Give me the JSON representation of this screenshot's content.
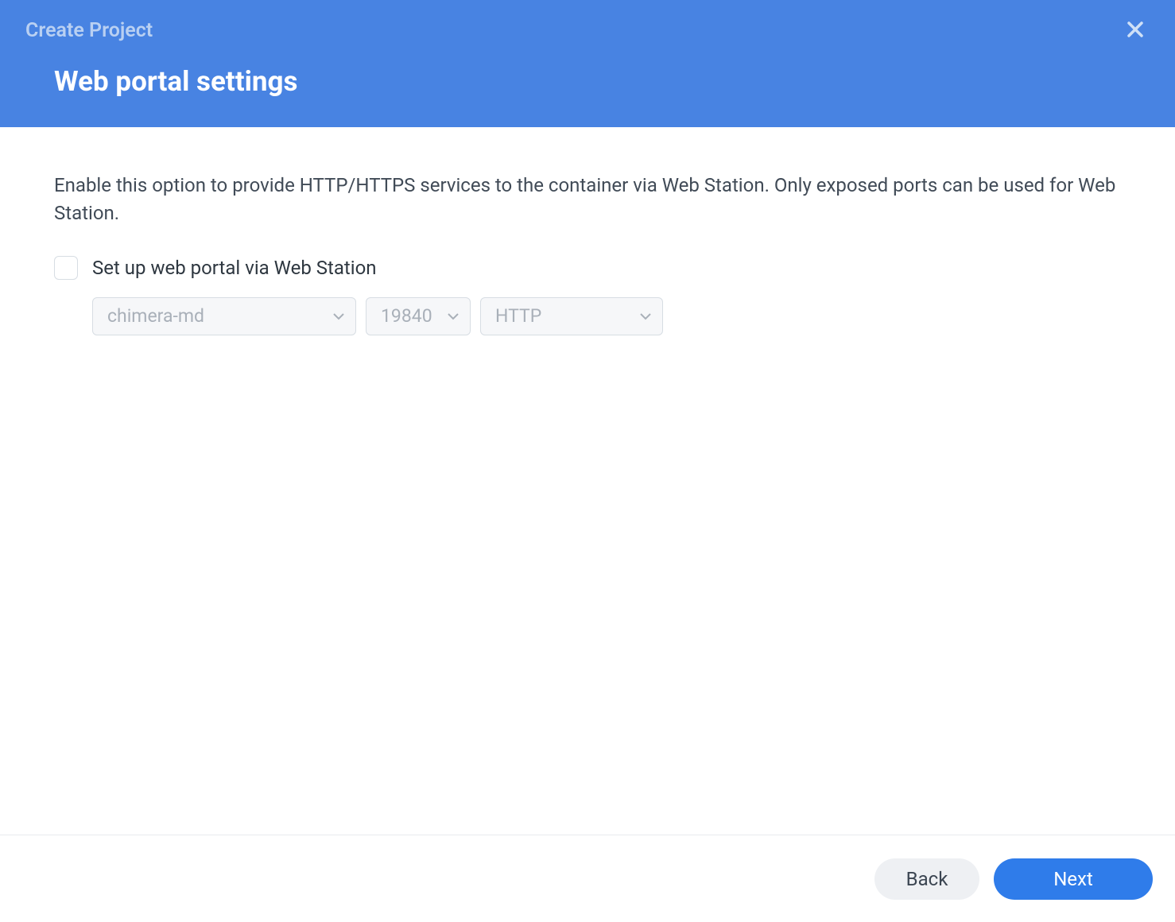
{
  "header": {
    "breadcrumb": "Create Project",
    "title": "Web portal settings"
  },
  "main": {
    "description": "Enable this option to provide HTTP/HTTPS services to the container via Web Station. Only exposed ports can be used for Web Station.",
    "checkbox_label": "Set up web portal via Web Station",
    "checkbox_checked": false,
    "selects": {
      "container": "chimera-md",
      "port": "19840",
      "protocol": "HTTP"
    }
  },
  "footer": {
    "back_label": "Back",
    "next_label": "Next"
  }
}
